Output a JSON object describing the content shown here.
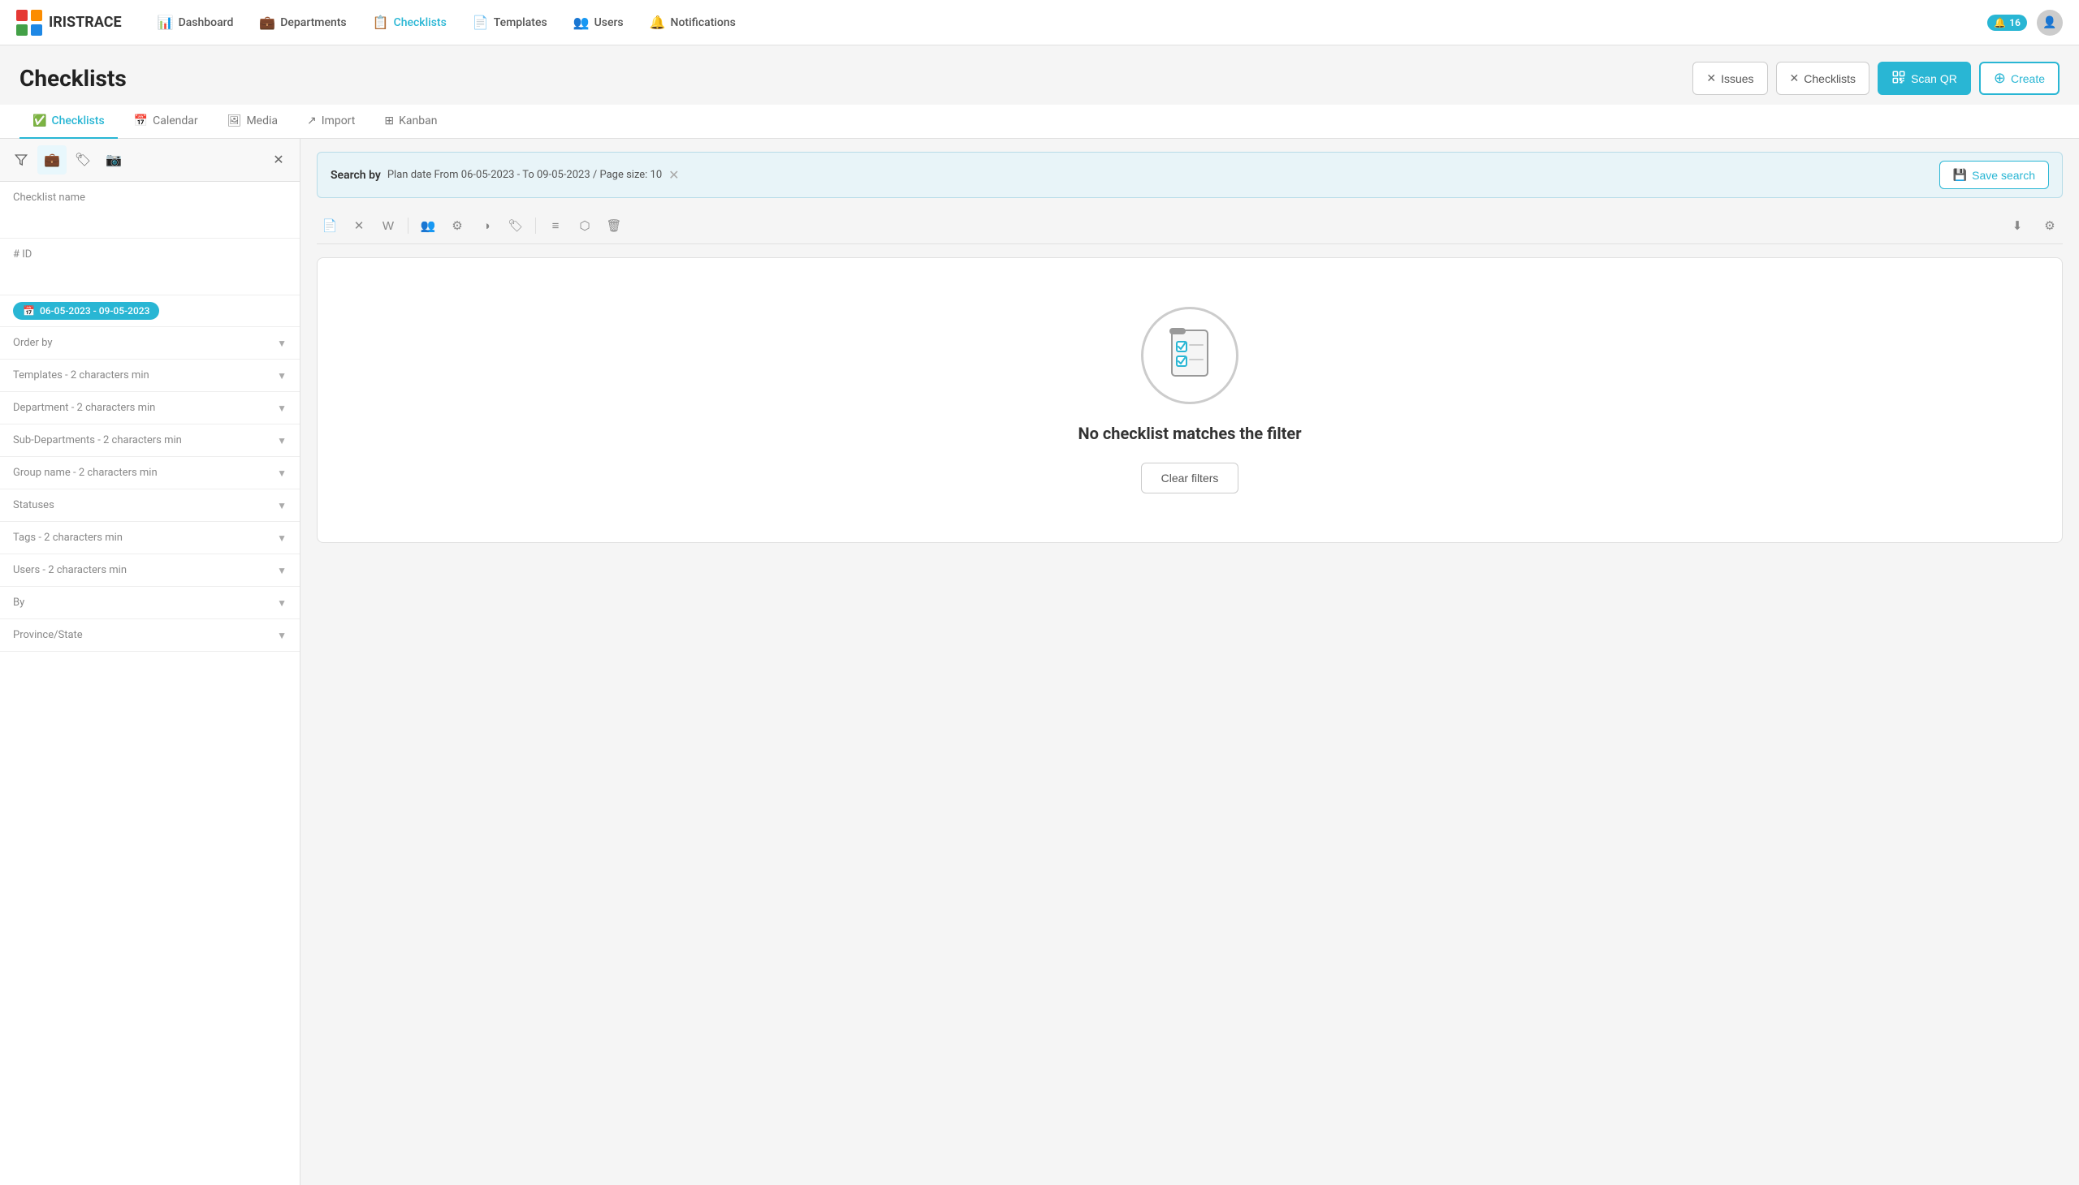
{
  "brand": {
    "name": "IRISTRACE"
  },
  "nav": {
    "items": [
      {
        "id": "dashboard",
        "label": "Dashboard",
        "icon": "📊"
      },
      {
        "id": "departments",
        "label": "Departments",
        "icon": "💼"
      },
      {
        "id": "checklists",
        "label": "Checklists",
        "icon": "📋",
        "active": true
      },
      {
        "id": "templates",
        "label": "Templates",
        "icon": "📄"
      },
      {
        "id": "users",
        "label": "Users",
        "icon": "👥"
      },
      {
        "id": "notifications",
        "label": "Notifications",
        "icon": "🔔"
      }
    ],
    "notification_count": "16"
  },
  "page": {
    "title": "Checklists"
  },
  "header_buttons": {
    "issues": "Issues",
    "checklists": "Checklists",
    "scan_qr": "Scan QR",
    "create": "Create"
  },
  "tabs": [
    {
      "id": "checklists",
      "label": "Checklists",
      "active": true
    },
    {
      "id": "calendar",
      "label": "Calendar"
    },
    {
      "id": "media",
      "label": "Media"
    },
    {
      "id": "import",
      "label": "Import"
    },
    {
      "id": "kanban",
      "label": "Kanban"
    }
  ],
  "sidebar": {
    "filters": [
      {
        "id": "checklist-name",
        "label": "Checklist name",
        "type": "input"
      },
      {
        "id": "id",
        "label": "# ID",
        "type": "input"
      },
      {
        "id": "date",
        "label": "06-05-2023 - 09-05-2023",
        "type": "date"
      },
      {
        "id": "order-by",
        "label": "Order by",
        "type": "dropdown"
      },
      {
        "id": "templates",
        "label": "Templates - 2 characters min",
        "type": "dropdown"
      },
      {
        "id": "department",
        "label": "Department - 2 characters min",
        "type": "dropdown"
      },
      {
        "id": "sub-departments",
        "label": "Sub-Departments - 2 characters min",
        "type": "dropdown"
      },
      {
        "id": "group-name",
        "label": "Group name - 2 characters min",
        "type": "dropdown"
      },
      {
        "id": "statuses",
        "label": "Statuses",
        "type": "dropdown"
      },
      {
        "id": "tags",
        "label": "Tags - 2 characters min",
        "type": "dropdown"
      },
      {
        "id": "users",
        "label": "Users - 2 characters min",
        "type": "dropdown"
      },
      {
        "id": "by",
        "label": "By",
        "type": "dropdown"
      },
      {
        "id": "province-state",
        "label": "Province/State",
        "type": "dropdown"
      }
    ]
  },
  "search_bar": {
    "label": "Search by",
    "value": "Plan date From 06-05-2023 - To 09-05-2023 / Page size: 10",
    "save_label": "Save search"
  },
  "toolbar": {
    "icons": [
      "📄",
      "✕",
      "W",
      "👥",
      "⚙",
      "◑",
      "🏷",
      "▪",
      "≡",
      "⬡",
      "🗑"
    ],
    "right_icons": [
      "⬇",
      "⚙"
    ]
  },
  "empty_state": {
    "message": "No checklist matches the filter",
    "clear_button": "Clear filters"
  }
}
